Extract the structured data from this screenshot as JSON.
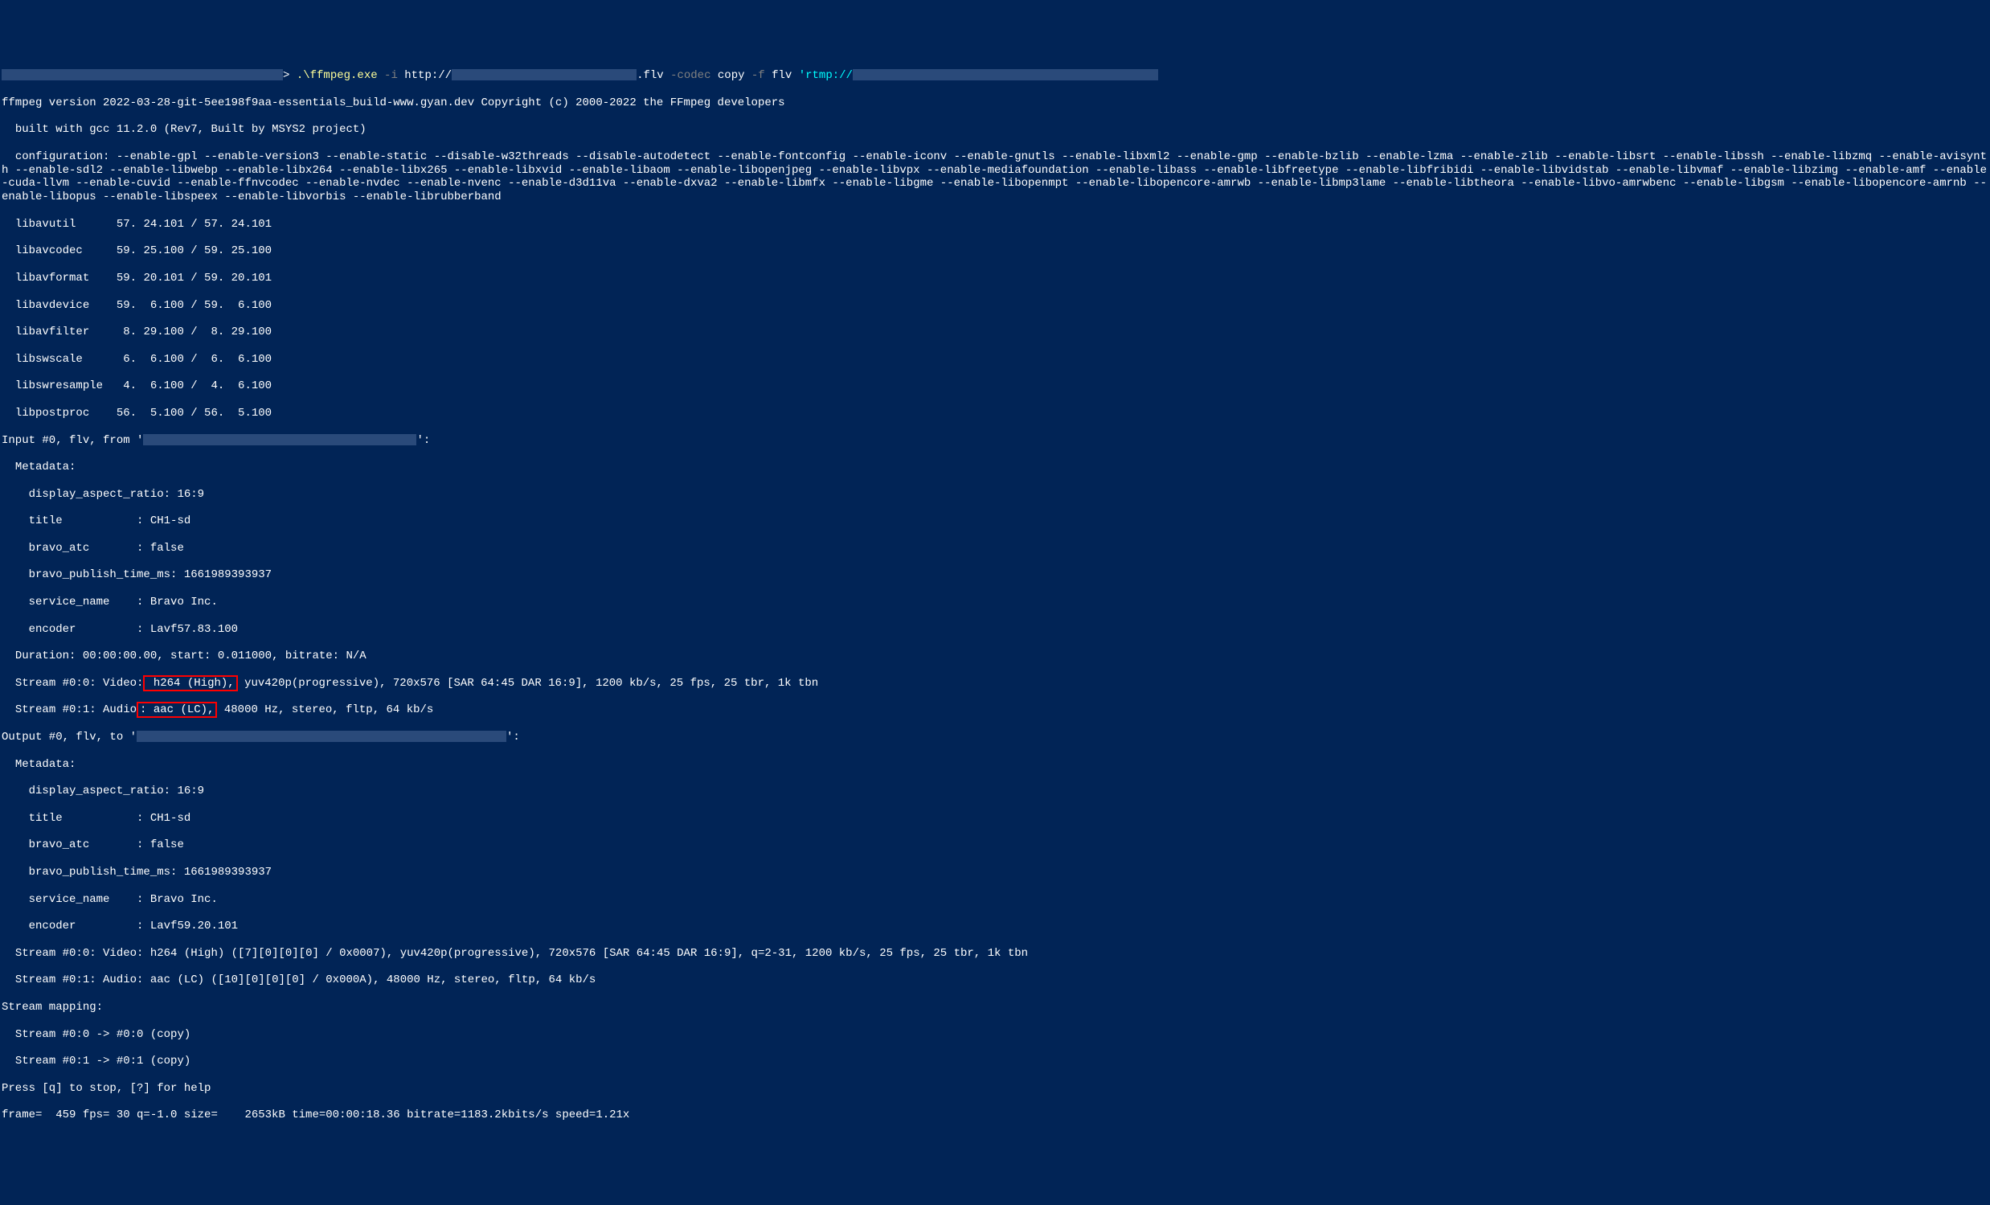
{
  "prompt": {
    "redacted1_width": 350,
    "path_prefix": "> ",
    "exe": ".\\ffmpeg.exe",
    "flag_i": " -i ",
    "url_prefix": "http://",
    "url_redacted_width": 230,
    "url_suffix": ".flv",
    "flag_codec": " -codec ",
    "codec_val": "copy",
    "flag_f": " -f ",
    "format_val": "flv ",
    "rtmp": "'rtmp://",
    "rtmp_redacted_width": 380
  },
  "version_line": "ffmpeg version 2022-03-28-git-5ee198f9aa-essentials_build-www.gyan.dev Copyright (c) 2000-2022 the FFmpeg developers",
  "built_line": "  built with gcc 11.2.0 (Rev7, Built by MSYS2 project)",
  "config_line": "  configuration: --enable-gpl --enable-version3 --enable-static --disable-w32threads --disable-autodetect --enable-fontconfig --enable-iconv --enable-gnutls --enable-libxml2 --enable-gmp --enable-bzlib --enable-lzma --enable-zlib --enable-libsrt --enable-libssh --enable-libzmq --enable-avisynth --enable-sdl2 --enable-libwebp --enable-libx264 --enable-libx265 --enable-libxvid --enable-libaom --enable-libopenjpeg --enable-libvpx --enable-mediafoundation --enable-libass --enable-libfreetype --enable-libfribidi --enable-libvidstab --enable-libvmaf --enable-libzimg --enable-amf --enable-cuda-llvm --enable-cuvid --enable-ffnvcodec --enable-nvdec --enable-nvenc --enable-d3d11va --enable-dxva2 --enable-libmfx --enable-libgme --enable-libopenmpt --enable-libopencore-amrwb --enable-libmp3lame --enable-libtheora --enable-libvo-amrwbenc --enable-libgsm --enable-libopencore-amrnb --enable-libopus --enable-libspeex --enable-libvorbis --enable-librubberband",
  "libs": [
    "  libavutil      57. 24.101 / 57. 24.101",
    "  libavcodec     59. 25.100 / 59. 25.100",
    "  libavformat    59. 20.101 / 59. 20.101",
    "  libavdevice    59.  6.100 / 59.  6.100",
    "  libavfilter     8. 29.100 /  8. 29.100",
    "  libswscale      6.  6.100 /  6.  6.100",
    "  libswresample   4.  6.100 /  4.  6.100",
    "  libpostproc    56.  5.100 / 56.  5.100"
  ],
  "input_prefix": "Input #0, flv, from '",
  "input_redacted_width": 340,
  "input_suffix": "':",
  "metadata_label": "  Metadata:",
  "metadata_in": [
    "    display_aspect_ratio: 16:9",
    "    title           : CH1-sd",
    "    bravo_atc       : false",
    "    bravo_publish_time_ms: 1661989393937",
    "    service_name    : Bravo Inc.",
    "    encoder         : Lavf57.83.100"
  ],
  "duration_line": "  Duration: 00:00:00.00, start: 0.011000, bitrate: N/A",
  "stream00_in_pre": "  Stream #0:0: Video:",
  "stream00_in_box": " h264 (High),",
  "stream00_in_post": " yuv420p(progressive), 720x576 [SAR 64:45 DAR 16:9], 1200 kb/s, 25 fps, 25 tbr, 1k tbn",
  "stream01_in_pre": "  Stream #0:1: Audio",
  "stream01_in_box": ": aac (LC),",
  "stream01_in_post": " 48000 Hz, stereo, fltp, 64 kb/s",
  "output_prefix": "Output #0, flv, to '",
  "output_redacted_width": 460,
  "output_suffix": "':",
  "metadata_out": [
    "    display_aspect_ratio: 16:9",
    "    title           : CH1-sd",
    "    bravo_atc       : false",
    "    bravo_publish_time_ms: 1661989393937",
    "    service_name    : Bravo Inc.",
    "    encoder         : Lavf59.20.101"
  ],
  "stream00_out": "  Stream #0:0: Video: h264 (High) ([7][0][0][0] / 0x0007), yuv420p(progressive), 720x576 [SAR 64:45 DAR 16:9], q=2-31, 1200 kb/s, 25 fps, 25 tbr, 1k tbn",
  "stream01_out": "  Stream #0:1: Audio: aac (LC) ([10][0][0][0] / 0x000A), 48000 Hz, stereo, fltp, 64 kb/s",
  "mapping_label": "Stream mapping:",
  "mapping": [
    "  Stream #0:0 -> #0:0 (copy)",
    "  Stream #0:1 -> #0:1 (copy)"
  ],
  "press_line": "Press [q] to stop, [?] for help",
  "frame_line": "frame=  459 fps= 30 q=-1.0 size=    2653kB time=00:00:18.36 bitrate=1183.2kbits/s speed=1.21x"
}
